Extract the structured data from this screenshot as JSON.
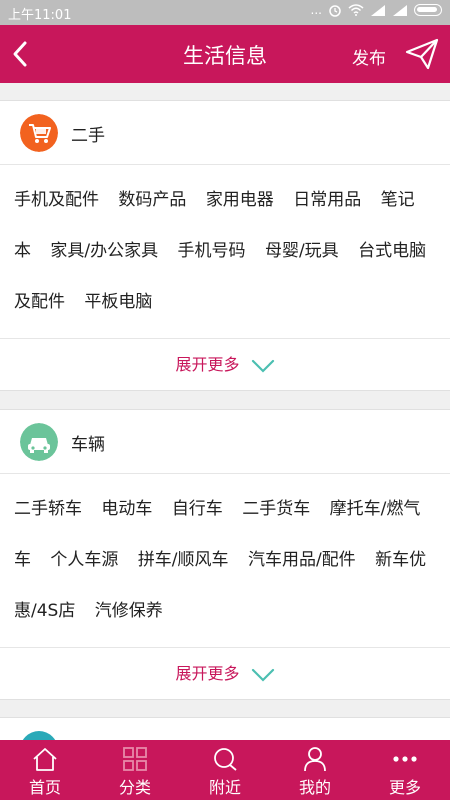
{
  "status_bar": {
    "time": "上午11:01",
    "icons": [
      "more-icon",
      "alarm-icon",
      "wifi-icon",
      "signal-icon",
      "signal-icon",
      "battery-icon"
    ],
    "dots": "..."
  },
  "nav": {
    "title": "生活信息",
    "publish_label": "发布",
    "back_icon": "chevron-left-icon",
    "send_icon": "paper-plane-icon"
  },
  "categories": [
    {
      "title": "二手",
      "icon": "shopping-cart-icon",
      "icon_color": "#f2621f",
      "tags": [
        "手机及配件",
        "数码产品",
        "家用电器",
        "日常用品",
        "笔记本",
        "家具/办公家具",
        "手机号码",
        "母婴/玩具",
        "台式电脑及配件",
        "平板电脑"
      ],
      "expand_label": "展开更多"
    },
    {
      "title": "车辆",
      "icon": "car-icon",
      "icon_color": "#6bc49a",
      "tags": [
        "二手轿车",
        "电动车",
        "自行车",
        "二手货车",
        "摩托车/燃气车",
        "个人车源",
        "拼车/顺风车",
        "汽车用品/配件",
        "新车优惠/4S店",
        "汽修保养"
      ],
      "expand_label": "展开更多"
    }
  ],
  "tab_bar": {
    "items": [
      {
        "label": "首页",
        "icon": "home-icon"
      },
      {
        "label": "分类",
        "icon": "grid-icon"
      },
      {
        "label": "附近",
        "icon": "search-icon"
      },
      {
        "label": "我的",
        "icon": "user-icon"
      },
      {
        "label": "更多",
        "icon": "more-dots-icon"
      }
    ],
    "active_index": 1
  },
  "colors": {
    "brand": "#c8175b",
    "chevron": "#4bbfb1",
    "status_bar": "#bdbdbd"
  }
}
